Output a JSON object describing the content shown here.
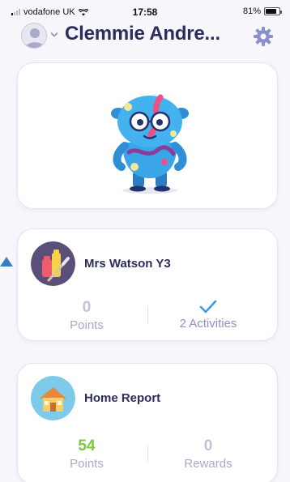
{
  "status": {
    "carrier": "vodafone UK",
    "time": "17:58",
    "battery": "81%",
    "battery_level": 0.81
  },
  "header": {
    "title": "Clemmie Andre...",
    "avatar_icon": "user-avatar-icon",
    "settings_icon": "gear-icon"
  },
  "hero": {
    "illustration": "blue-monster-mascot"
  },
  "class_card": {
    "name": "Mrs Watson Y3",
    "points_value": "0",
    "points_label": "Points",
    "activities_label": "2 Activities",
    "icon": "art-supplies-icon"
  },
  "home_card": {
    "name": "Home Report",
    "points_value": "54",
    "points_label": "Points",
    "rewards_value": "0",
    "rewards_label": "Rewards",
    "icon": "house-icon"
  },
  "colors": {
    "title": "#2b2d5c",
    "accent_blue": "#3a9be0",
    "green": "#79c93a",
    "gear": "#8b91c9"
  }
}
